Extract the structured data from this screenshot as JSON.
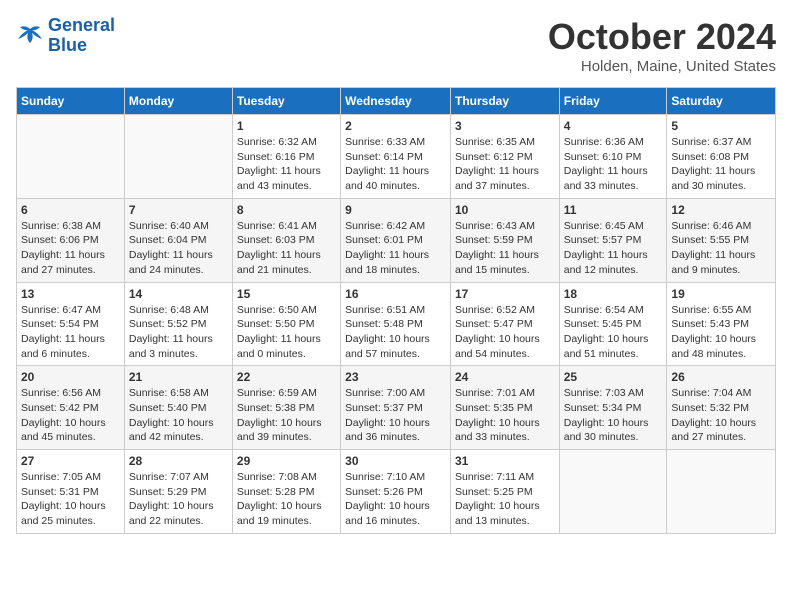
{
  "header": {
    "logo_line1": "General",
    "logo_line2": "Blue",
    "month": "October 2024",
    "location": "Holden, Maine, United States"
  },
  "days_of_week": [
    "Sunday",
    "Monday",
    "Tuesday",
    "Wednesday",
    "Thursday",
    "Friday",
    "Saturday"
  ],
  "weeks": [
    [
      {
        "day": "",
        "sunrise": "",
        "sunset": "",
        "daylight": ""
      },
      {
        "day": "",
        "sunrise": "",
        "sunset": "",
        "daylight": ""
      },
      {
        "day": "1",
        "sunrise": "Sunrise: 6:32 AM",
        "sunset": "Sunset: 6:16 PM",
        "daylight": "Daylight: 11 hours and 43 minutes."
      },
      {
        "day": "2",
        "sunrise": "Sunrise: 6:33 AM",
        "sunset": "Sunset: 6:14 PM",
        "daylight": "Daylight: 11 hours and 40 minutes."
      },
      {
        "day": "3",
        "sunrise": "Sunrise: 6:35 AM",
        "sunset": "Sunset: 6:12 PM",
        "daylight": "Daylight: 11 hours and 37 minutes."
      },
      {
        "day": "4",
        "sunrise": "Sunrise: 6:36 AM",
        "sunset": "Sunset: 6:10 PM",
        "daylight": "Daylight: 11 hours and 33 minutes."
      },
      {
        "day": "5",
        "sunrise": "Sunrise: 6:37 AM",
        "sunset": "Sunset: 6:08 PM",
        "daylight": "Daylight: 11 hours and 30 minutes."
      }
    ],
    [
      {
        "day": "6",
        "sunrise": "Sunrise: 6:38 AM",
        "sunset": "Sunset: 6:06 PM",
        "daylight": "Daylight: 11 hours and 27 minutes."
      },
      {
        "day": "7",
        "sunrise": "Sunrise: 6:40 AM",
        "sunset": "Sunset: 6:04 PM",
        "daylight": "Daylight: 11 hours and 24 minutes."
      },
      {
        "day": "8",
        "sunrise": "Sunrise: 6:41 AM",
        "sunset": "Sunset: 6:03 PM",
        "daylight": "Daylight: 11 hours and 21 minutes."
      },
      {
        "day": "9",
        "sunrise": "Sunrise: 6:42 AM",
        "sunset": "Sunset: 6:01 PM",
        "daylight": "Daylight: 11 hours and 18 minutes."
      },
      {
        "day": "10",
        "sunrise": "Sunrise: 6:43 AM",
        "sunset": "Sunset: 5:59 PM",
        "daylight": "Daylight: 11 hours and 15 minutes."
      },
      {
        "day": "11",
        "sunrise": "Sunrise: 6:45 AM",
        "sunset": "Sunset: 5:57 PM",
        "daylight": "Daylight: 11 hours and 12 minutes."
      },
      {
        "day": "12",
        "sunrise": "Sunrise: 6:46 AM",
        "sunset": "Sunset: 5:55 PM",
        "daylight": "Daylight: 11 hours and 9 minutes."
      }
    ],
    [
      {
        "day": "13",
        "sunrise": "Sunrise: 6:47 AM",
        "sunset": "Sunset: 5:54 PM",
        "daylight": "Daylight: 11 hours and 6 minutes."
      },
      {
        "day": "14",
        "sunrise": "Sunrise: 6:48 AM",
        "sunset": "Sunset: 5:52 PM",
        "daylight": "Daylight: 11 hours and 3 minutes."
      },
      {
        "day": "15",
        "sunrise": "Sunrise: 6:50 AM",
        "sunset": "Sunset: 5:50 PM",
        "daylight": "Daylight: 11 hours and 0 minutes."
      },
      {
        "day": "16",
        "sunrise": "Sunrise: 6:51 AM",
        "sunset": "Sunset: 5:48 PM",
        "daylight": "Daylight: 10 hours and 57 minutes."
      },
      {
        "day": "17",
        "sunrise": "Sunrise: 6:52 AM",
        "sunset": "Sunset: 5:47 PM",
        "daylight": "Daylight: 10 hours and 54 minutes."
      },
      {
        "day": "18",
        "sunrise": "Sunrise: 6:54 AM",
        "sunset": "Sunset: 5:45 PM",
        "daylight": "Daylight: 10 hours and 51 minutes."
      },
      {
        "day": "19",
        "sunrise": "Sunrise: 6:55 AM",
        "sunset": "Sunset: 5:43 PM",
        "daylight": "Daylight: 10 hours and 48 minutes."
      }
    ],
    [
      {
        "day": "20",
        "sunrise": "Sunrise: 6:56 AM",
        "sunset": "Sunset: 5:42 PM",
        "daylight": "Daylight: 10 hours and 45 minutes."
      },
      {
        "day": "21",
        "sunrise": "Sunrise: 6:58 AM",
        "sunset": "Sunset: 5:40 PM",
        "daylight": "Daylight: 10 hours and 42 minutes."
      },
      {
        "day": "22",
        "sunrise": "Sunrise: 6:59 AM",
        "sunset": "Sunset: 5:38 PM",
        "daylight": "Daylight: 10 hours and 39 minutes."
      },
      {
        "day": "23",
        "sunrise": "Sunrise: 7:00 AM",
        "sunset": "Sunset: 5:37 PM",
        "daylight": "Daylight: 10 hours and 36 minutes."
      },
      {
        "day": "24",
        "sunrise": "Sunrise: 7:01 AM",
        "sunset": "Sunset: 5:35 PM",
        "daylight": "Daylight: 10 hours and 33 minutes."
      },
      {
        "day": "25",
        "sunrise": "Sunrise: 7:03 AM",
        "sunset": "Sunset: 5:34 PM",
        "daylight": "Daylight: 10 hours and 30 minutes."
      },
      {
        "day": "26",
        "sunrise": "Sunrise: 7:04 AM",
        "sunset": "Sunset: 5:32 PM",
        "daylight": "Daylight: 10 hours and 27 minutes."
      }
    ],
    [
      {
        "day": "27",
        "sunrise": "Sunrise: 7:05 AM",
        "sunset": "Sunset: 5:31 PM",
        "daylight": "Daylight: 10 hours and 25 minutes."
      },
      {
        "day": "28",
        "sunrise": "Sunrise: 7:07 AM",
        "sunset": "Sunset: 5:29 PM",
        "daylight": "Daylight: 10 hours and 22 minutes."
      },
      {
        "day": "29",
        "sunrise": "Sunrise: 7:08 AM",
        "sunset": "Sunset: 5:28 PM",
        "daylight": "Daylight: 10 hours and 19 minutes."
      },
      {
        "day": "30",
        "sunrise": "Sunrise: 7:10 AM",
        "sunset": "Sunset: 5:26 PM",
        "daylight": "Daylight: 10 hours and 16 minutes."
      },
      {
        "day": "31",
        "sunrise": "Sunrise: 7:11 AM",
        "sunset": "Sunset: 5:25 PM",
        "daylight": "Daylight: 10 hours and 13 minutes."
      },
      {
        "day": "",
        "sunrise": "",
        "sunset": "",
        "daylight": ""
      },
      {
        "day": "",
        "sunrise": "",
        "sunset": "",
        "daylight": ""
      }
    ]
  ]
}
